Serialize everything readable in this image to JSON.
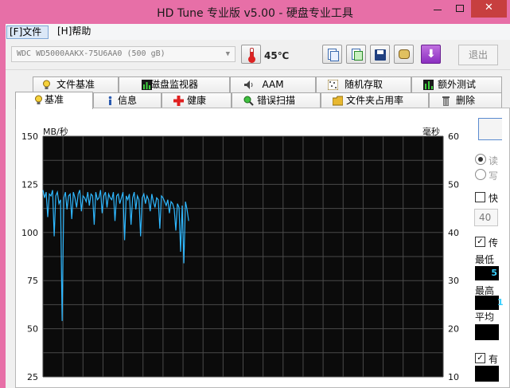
{
  "window": {
    "title": "HD Tune 专业版 v5.00 - 硬盘专业工具"
  },
  "menu": {
    "file": "[F]文件",
    "help": "[H]帮助"
  },
  "toolbar": {
    "drive": "WDC WD5000AAKX-75U6AA0 (500 gB)",
    "temperature": "45℃",
    "exit_label": "退出"
  },
  "tabs_row1": [
    "文件基准",
    "磁盘监视器",
    "AAM",
    "随机存取",
    "额外测试"
  ],
  "tabs_row2": [
    "基准",
    "信息",
    "健康",
    "错误扫描",
    "文件夹占用率",
    "删除"
  ],
  "side": {
    "input_value": "40",
    "min_label": "最低",
    "max_label": "最高",
    "avg_label": "平均",
    "partial_chars": [
      "读",
      "写",
      "快",
      "传",
      "有"
    ],
    "readouts": [
      "5",
      "1"
    ]
  },
  "colors": {
    "accent": "#e76fa7",
    "plot_bg": "#0b0b0b",
    "grid": "#4a4a4a",
    "series": "#2fb8ff"
  },
  "chart_data": {
    "type": "line",
    "ylabel": "MB/秒",
    "y2label": "毫秒",
    "ylim": [
      25,
      150
    ],
    "y2lim": [
      10,
      60
    ],
    "yticks": [
      "150",
      "125",
      "100",
      "75",
      "50",
      "25"
    ],
    "y2ticks": [
      "60",
      "50",
      "40",
      "30",
      "20",
      "10"
    ],
    "grid": true,
    "xlim": [
      0,
      100
    ],
    "series": [
      {
        "x": [
          0,
          0.4,
          0.8,
          1.2,
          1.6,
          2.0,
          2.4,
          2.8,
          3.2,
          3.6,
          4.0,
          4.4,
          4.8,
          5.2,
          5.6,
          6.0,
          6.4,
          6.8,
          7.2,
          7.6,
          8.0,
          8.4,
          8.8,
          9.2,
          9.6,
          10.0,
          10.4,
          10.8,
          11.2,
          11.6,
          12.0,
          12.4,
          12.8,
          13.2,
          13.6,
          14.0,
          14.4,
          14.8,
          15.2,
          15.6,
          16.0,
          16.4,
          16.8,
          17.2,
          17.6,
          18.0,
          18.4,
          18.8,
          19.2,
          19.6,
          20.0,
          20.4,
          20.8,
          21.2,
          21.6,
          22.0,
          22.4,
          22.8,
          23.2,
          23.6,
          24.0,
          24.4,
          24.8,
          25.2,
          25.6,
          26.0,
          26.4,
          26.8,
          27.2,
          27.6,
          28.0,
          28.4,
          28.8,
          29.2,
          29.6,
          30.0,
          30.4,
          30.8,
          31.2,
          31.6,
          32.0,
          32.4,
          32.8,
          33.2,
          33.6,
          34.0,
          34.4,
          34.8,
          35.2,
          35.6,
          36.0,
          36.4
        ],
        "values": [
          122,
          118,
          121,
          108,
          120,
          119,
          122,
          98,
          119,
          121,
          115,
          117,
          54,
          118,
          121,
          112,
          119,
          120,
          107,
          121,
          118,
          113,
          120,
          122,
          111,
          119,
          118,
          116,
          121,
          114,
          120,
          119,
          104,
          121,
          117,
          118,
          122,
          110,
          119,
          121,
          113,
          120,
          118,
          117,
          121,
          106,
          119,
          120,
          115,
          118,
          121,
          96,
          119,
          117,
          120,
          104,
          118,
          121,
          112,
          119,
          117,
          98,
          118,
          120,
          115,
          119,
          117,
          111,
          120,
          116,
          113,
          118,
          117,
          102,
          119,
          118,
          116,
          114,
          117,
          110,
          116,
          115,
          112,
          101,
          115,
          113,
          90,
          114,
          84,
          116,
          112,
          106
        ]
      }
    ]
  }
}
